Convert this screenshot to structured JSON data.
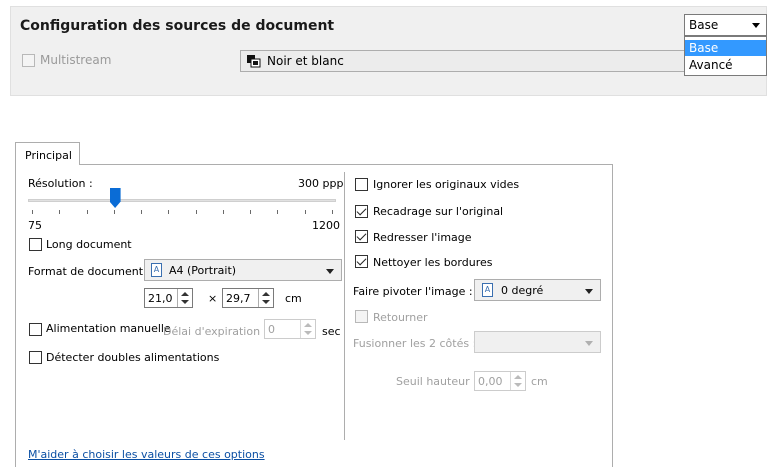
{
  "header": {
    "title": "Configuration des sources de document",
    "multistream_label": "Multistream",
    "color_mode": "Noir et blanc",
    "color_mode_icon": "bw-color-icon"
  },
  "mode_dropdown": {
    "value": "Base",
    "options": [
      "Base",
      "Avancé"
    ],
    "selected_color": "#3399ff"
  },
  "tabs": [
    {
      "label": "Principal"
    }
  ],
  "left": {
    "resolution_label": "Résolution :",
    "resolution_value": "300 ppp",
    "slider": {
      "min": "75",
      "max": "1200",
      "value": 300
    },
    "long_document": "Long document",
    "format_label": "Format de document :",
    "format_value": "A4 (Portrait)",
    "width_value": "21,0",
    "height_value": "29,7",
    "times": "×",
    "unit_cm": "cm",
    "manual_feed": "Alimentation manuelle",
    "timeout_label": "Délai d'expiration :",
    "timeout_value": "0",
    "unit_sec": "sec",
    "double_feed": "Détecter doubles alimentations"
  },
  "right": {
    "ignore_blank": "Ignorer les originaux vides",
    "crop_original": "Recadrage sur l'original",
    "straighten": "Redresser l'image",
    "clean_borders": "Nettoyer les bordures",
    "rotate_label": "Faire pivoter l'image :",
    "rotate_value": "0 degré",
    "flip": "Retourner",
    "merge_label": "Fusionner les 2 côtés :",
    "height_threshold_label": "Seuil hauteur :",
    "height_threshold_value": "0,00",
    "unit_cm": "cm"
  },
  "help_link": "M'aider à choisir les valeurs de ces options"
}
